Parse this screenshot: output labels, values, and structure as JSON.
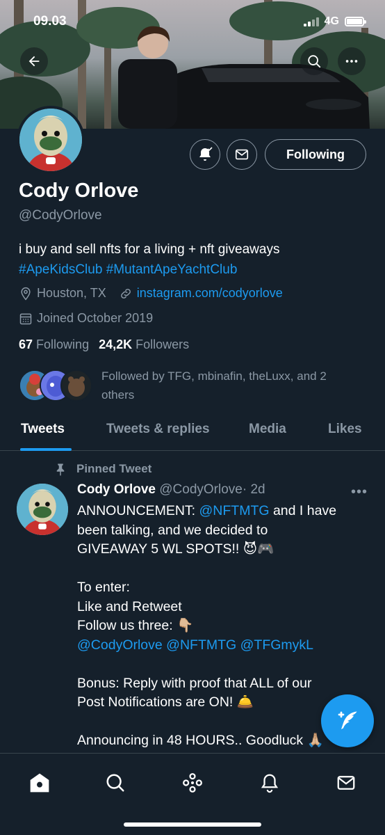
{
  "status_bar": {
    "time": "09.03",
    "network": "4G"
  },
  "profile": {
    "name": "Cody Orlove",
    "handle": "@CodyOrlove",
    "bio_text": "i buy and sell nfts for a living + nft giveaways",
    "bio_hashtags": [
      "#ApeKidsClub",
      "#MutantApeYachtClub"
    ],
    "location": "Houston, TX",
    "website": "instagram.com/codyorlove",
    "joined": "Joined October 2019",
    "following_count": "67",
    "following_label": "Following",
    "followers_count": "24,2K",
    "followers_label": "Followers",
    "followed_by_line1": "Followed by TFG, mbinafin, theLuxx, and 2",
    "followed_by_line2": "others",
    "follow_button": "Following"
  },
  "tabs": [
    {
      "label": "Tweets",
      "active": true
    },
    {
      "label": "Tweets & replies",
      "active": false
    },
    {
      "label": "Media",
      "active": false
    },
    {
      "label": "Likes",
      "active": false
    }
  ],
  "pinned_tweet": {
    "pinned_label": "Pinned Tweet",
    "author_name": "Cody Orlove",
    "author_handle": "@CodyOrlove",
    "time": "· 2d",
    "more": "•••",
    "line1_a": "ANNOUNCEMENT: ",
    "line1_mention": "@NFTMTG",
    "line1_b": " and I have",
    "line2": "been talking, and we decided to",
    "line3": "GIVEAWAY 5 WL SPOTS!! 😈🎮",
    "line4": "To enter:",
    "line5": "Like and Retweet",
    "line6": "Follow us three: 👇🏼",
    "mentions": " @CodyOrlove @NFTMTG @TFGmykL",
    "line8": "Bonus: Reply with proof that ALL of our",
    "line9": "Post Notifications are ON! 🛎️",
    "line10": "Announcing in 48 HOURS.. Goodluck 🙏🏼"
  },
  "colors": {
    "background": "#15202b",
    "accent": "#1d9bf0",
    "muted": "#8b98a5",
    "divider": "#38444d"
  },
  "icons": [
    "back-arrow-icon",
    "search-icon",
    "more-icon",
    "bell-notification-icon",
    "mail-icon",
    "location-icon",
    "link-icon",
    "calendar-icon",
    "pin-icon",
    "compose-icon",
    "home-icon",
    "explore-icon",
    "spaces-icon",
    "notifications-icon",
    "messages-icon"
  ]
}
